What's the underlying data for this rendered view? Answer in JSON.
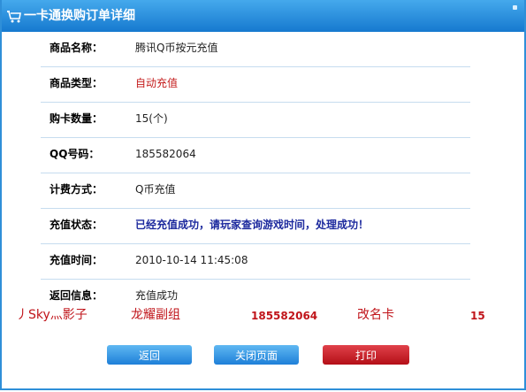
{
  "window": {
    "title": "一卡通换购订单详细"
  },
  "rows": [
    {
      "label": "商品名称：",
      "value": "腾讯Q币按元充值",
      "style": "normal"
    },
    {
      "label": "商品类型：",
      "value": "自动充值",
      "style": "red"
    },
    {
      "label": "购卡数量：",
      "value": "15(个)",
      "style": "normal"
    },
    {
      "label": "QQ号码：",
      "value": "185582064",
      "style": "normal"
    },
    {
      "label": "计费方式：",
      "value": "Q币充值",
      "style": "normal"
    },
    {
      "label": "充值状态：",
      "value": "已经充值成功，请玩家查询游戏时间，处理成功！",
      "style": "blue"
    },
    {
      "label": "充值时间：",
      "value": "2010-10-14 11:45:08",
      "style": "normal"
    },
    {
      "label": "返回信息：",
      "value": "充值成功",
      "style": "normal"
    }
  ],
  "overlay": {
    "name": "丿Sky灬影子",
    "guild": "龙耀副组",
    "qq": "185582064",
    "action": "改名卡",
    "count": "15"
  },
  "buttons": {
    "back": "返回",
    "close": "关闭页面",
    "print": "打印"
  },
  "colors": {
    "titlebar": "#1679cf",
    "accent_red": "#c41c1c",
    "status_blue": "#1d2a9e"
  }
}
